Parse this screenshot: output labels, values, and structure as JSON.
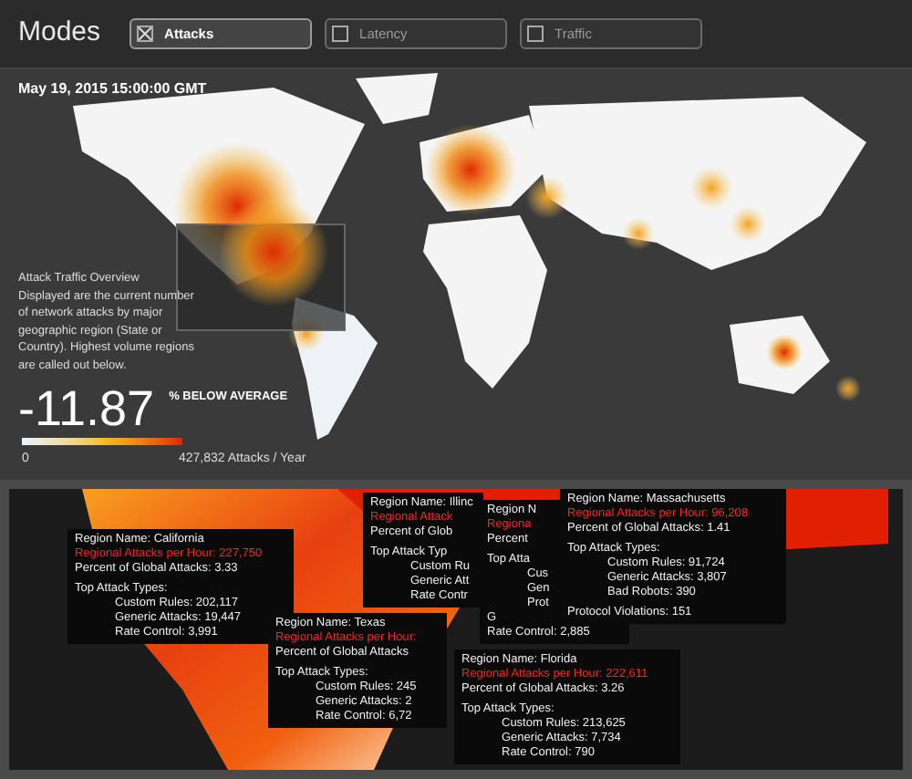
{
  "header": {
    "title": "Modes",
    "modes": [
      {
        "label": "Attacks",
        "selected": true
      },
      {
        "label": "Latency",
        "selected": false
      },
      {
        "label": "Traffic",
        "selected": false
      }
    ]
  },
  "map": {
    "timestamp": "May 19, 2015 15:00:00 GMT",
    "overview": {
      "title": "Attack Traffic Overview",
      "text": "Displayed are the current number of network attacks by major geographic region (State or Country). Highest volume regions are called out below."
    },
    "stat": {
      "value": "-11.87",
      "label": "% BELOW AVERAGE"
    },
    "legend": {
      "min": "0",
      "max": "427,832 Attacks / Year"
    }
  },
  "callouts": [
    {
      "lines": [
        {
          "kind": "plain",
          "text": "Region Name: California"
        },
        {
          "kind": "alert",
          "text": "Regional Attacks per Hour: 227,750"
        },
        {
          "kind": "plain",
          "text": "Percent of Global Attacks: 3.33"
        },
        {
          "kind": "heading",
          "text": "Top Attack Types:"
        },
        {
          "kind": "item",
          "text": "Custom Rules: 202,117"
        },
        {
          "kind": "item",
          "text": "Generic Attacks: 19,447"
        },
        {
          "kind": "item",
          "text": "Rate Control: 3,991"
        }
      ]
    },
    {
      "lines": [
        {
          "kind": "plain",
          "text": "Region Name: Illinc"
        },
        {
          "kind": "alert",
          "text": "Regional Attack"
        },
        {
          "kind": "plain",
          "text": "Percent of Glob"
        },
        {
          "kind": "heading",
          "text": "Top Attack Typ"
        },
        {
          "kind": "item",
          "text": "Custom Ru"
        },
        {
          "kind": "item",
          "text": "Generic Att"
        },
        {
          "kind": "item",
          "text": "Rate Contr"
        }
      ]
    },
    {
      "lines": [
        {
          "kind": "plain",
          "text": "Region N"
        },
        {
          "kind": "alert",
          "text": "Regiona"
        },
        {
          "kind": "plain",
          "text": "Percent"
        },
        {
          "kind": "heading",
          "text": "Top Atta"
        },
        {
          "kind": "item",
          "text": "Cus"
        },
        {
          "kind": "item",
          "text": "Gen"
        },
        {
          "kind": "item",
          "text": "Prot"
        },
        {
          "kind": "plain",
          "text": "G"
        },
        {
          "kind": "plain",
          "text": "Rate Control: 2,885"
        }
      ]
    },
    {
      "lines": [
        {
          "kind": "plain",
          "text": "Region Name: Massachusetts"
        },
        {
          "kind": "alert",
          "text": "Regional Attacks per Hour: 96,208"
        },
        {
          "kind": "plain",
          "text": "Percent of Global Attacks: 1.41"
        },
        {
          "kind": "heading",
          "text": "Top Attack Types:"
        },
        {
          "kind": "item",
          "text": "Custom Rules: 91,724"
        },
        {
          "kind": "item",
          "text": "Generic Attacks: 3,807"
        },
        {
          "kind": "item",
          "text": "Bad Robots: 390"
        },
        {
          "kind": "heading",
          "text": "Protocol Violations: 151"
        }
      ]
    },
    {
      "lines": [
        {
          "kind": "plain",
          "text": "Region Name: Texas"
        },
        {
          "kind": "alert",
          "text": "Regional Attacks per Hour:"
        },
        {
          "kind": "plain",
          "text": "Percent of Global Attacks"
        },
        {
          "kind": "heading",
          "text": "Top Attack Types:"
        },
        {
          "kind": "item",
          "text": "Custom Rules: 245"
        },
        {
          "kind": "item",
          "text": "Generic Attacks: 2"
        },
        {
          "kind": "item",
          "text": "Rate Control: 6,72"
        }
      ]
    },
    {
      "lines": [
        {
          "kind": "plain",
          "text": "Region Name: Florida"
        },
        {
          "kind": "alert",
          "text": "Regional Attacks per Hour: 222,611"
        },
        {
          "kind": "plain",
          "text": "Percent of Global Attacks: 3.26"
        },
        {
          "kind": "heading",
          "text": "Top Attack Types:"
        },
        {
          "kind": "item",
          "text": "Custom Rules: 213,625"
        },
        {
          "kind": "item",
          "text": "Generic Attacks: 7,734"
        },
        {
          "kind": "item",
          "text": "Rate Control: 790"
        }
      ]
    }
  ]
}
